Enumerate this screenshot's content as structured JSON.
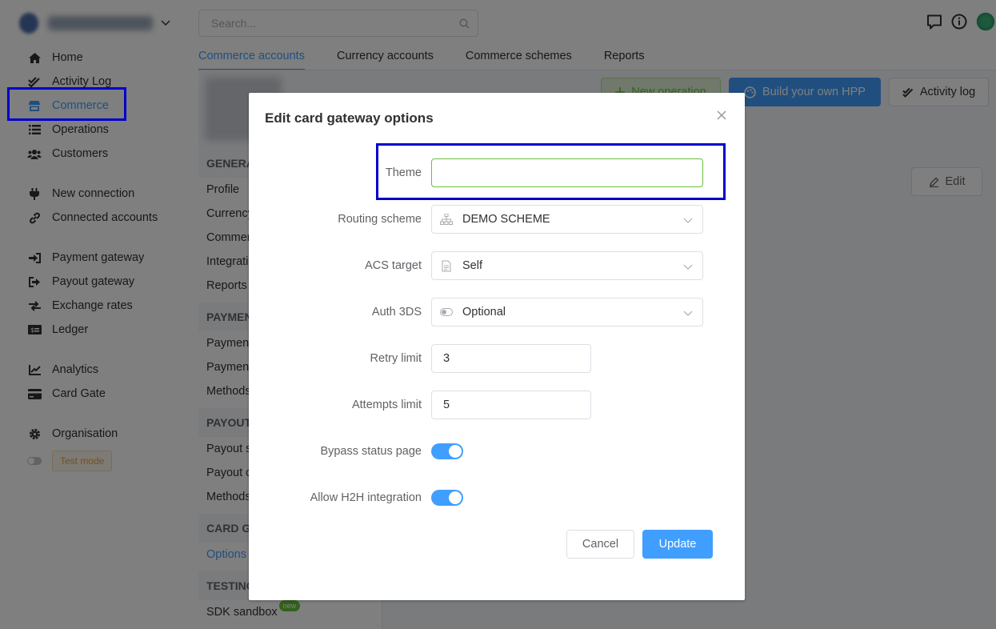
{
  "search": {
    "placeholder": "Search..."
  },
  "sidebar": {
    "items": [
      {
        "label": "Home",
        "icon": "home-icon"
      },
      {
        "label": "Activity Log",
        "icon": "double-check-icon"
      },
      {
        "label": "Commerce",
        "icon": "store-icon",
        "active": true
      },
      {
        "label": "Operations",
        "icon": "list-icon"
      },
      {
        "label": "Customers",
        "icon": "users-icon"
      },
      {
        "label": "New connection",
        "icon": "plug-icon"
      },
      {
        "label": "Connected accounts",
        "icon": "link-icon"
      },
      {
        "label": "Payment gateway",
        "icon": "sign-in-icon"
      },
      {
        "label": "Payout gateway",
        "icon": "sign-out-icon"
      },
      {
        "label": "Exchange rates",
        "icon": "exchange-icon"
      },
      {
        "label": "Ledger",
        "icon": "money-bill-icon"
      },
      {
        "label": "Analytics",
        "icon": "chart-line-icon"
      },
      {
        "label": "Card Gate",
        "icon": "credit-card-icon"
      },
      {
        "label": "Organisation",
        "icon": "gear-icon"
      }
    ],
    "test_mode": "Test mode"
  },
  "tabs": [
    "Commerce accounts",
    "Currency accounts",
    "Commerce schemes",
    "Reports"
  ],
  "background": {
    "buttons": {
      "new_operation": "New operation",
      "build_hpp": "Build your own HPP",
      "activity_log": "Activity log",
      "edit": "Edit"
    },
    "sections": [
      {
        "title": "GENERA",
        "items": [
          "Profile",
          "Currency",
          "Commer",
          "Integrati",
          "Reports"
        ]
      },
      {
        "title": "PAYMEN",
        "items": [
          "Payment",
          "Payment",
          "Methods"
        ]
      },
      {
        "title": "PAYOUT",
        "items": [
          "Payout s",
          "Payout c",
          "Methods"
        ]
      },
      {
        "title": "CARD GA",
        "items": [
          "Options"
        ]
      },
      {
        "title": "TESTING",
        "items": [
          "SDK sandbox"
        ]
      }
    ],
    "new_badge": "new"
  },
  "dialog": {
    "title": "Edit card gateway options",
    "fields": {
      "theme": {
        "label": "Theme",
        "value": ""
      },
      "routing_scheme": {
        "label": "Routing scheme",
        "value": "DEMO SCHEME",
        "icon": "sitemap-icon"
      },
      "acs_target": {
        "label": "ACS target",
        "value": "Self",
        "icon": "file-icon"
      },
      "auth_3ds": {
        "label": "Auth 3DS",
        "value": "Optional",
        "icon": "toggle-icon"
      },
      "retry_limit": {
        "label": "Retry limit",
        "value": "3"
      },
      "attempts_limit": {
        "label": "Attempts limit",
        "value": "5"
      },
      "bypass_status_page": {
        "label": "Bypass status page",
        "value": true
      },
      "allow_h2h": {
        "label": "Allow H2H integration",
        "value": true
      }
    },
    "cancel": "Cancel",
    "update": "Update"
  },
  "colors": {
    "primary": "#409eff",
    "focus_border": "#67c23a",
    "highlight": "#0000cc"
  }
}
